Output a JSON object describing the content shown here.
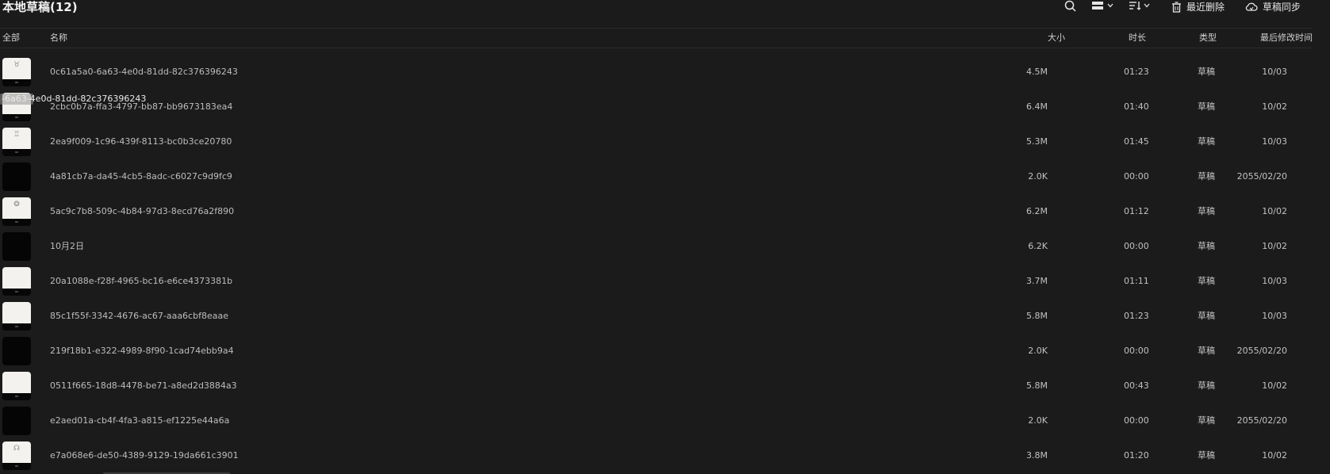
{
  "header": {
    "title": "本地草稿(12)",
    "recent_delete_label": "最近删除",
    "sync_label": "草稿同步"
  },
  "icons": {
    "search": "search-icon",
    "layout": "layout-view-icon",
    "sort": "sort-icon",
    "trash": "trash-icon",
    "cloud": "cloud-sync-icon"
  },
  "columns": {
    "all": "全部",
    "name": "名称",
    "size": "大小",
    "duration": "时长",
    "type": "类型",
    "modified": "最后修改时间"
  },
  "drag_ghost": {
    "text": "-6a63-4e0d-81dd-82c376396243"
  },
  "rows": [
    {
      "name": "0c61a5a0-6a63-4e0d-81dd-82c376396243",
      "size": "4.5M",
      "duration": "01:23",
      "type": "草稿",
      "modified": "10/03",
      "thumb": "paper",
      "glyph": "♉"
    },
    {
      "name": "2cbc0b7a-ffa3-4797-bb87-bb9673183ea4",
      "size": "6.4M",
      "duration": "01:40",
      "type": "草稿",
      "modified": "10/02",
      "thumb": "paper",
      "glyph": ""
    },
    {
      "name": "2ea9f009-1c96-439f-8113-bc0b3ce20780",
      "size": "5.3M",
      "duration": "01:45",
      "type": "草稿",
      "modified": "10/03",
      "thumb": "paper",
      "glyph": "♖"
    },
    {
      "name": "4a81cb7a-da45-4cb5-8adc-c6027c9d9fc9",
      "size": "2.0K",
      "duration": "00:00",
      "type": "草稿",
      "modified": "2055/02/20",
      "thumb": "dark",
      "glyph": ""
    },
    {
      "name": "5ac9c7b8-509c-4b84-97d3-8ecd76a2f890",
      "size": "6.2M",
      "duration": "01:12",
      "type": "草稿",
      "modified": "10/02",
      "thumb": "paper",
      "glyph": "❂"
    },
    {
      "name": "10月2日",
      "size": "6.2K",
      "duration": "00:00",
      "type": "草稿",
      "modified": "10/02",
      "thumb": "dark",
      "glyph": ""
    },
    {
      "name": "20a1088e-f28f-4965-bc16-e6ce4373381b",
      "size": "3.7M",
      "duration": "01:11",
      "type": "草稿",
      "modified": "10/03",
      "thumb": "paper",
      "glyph": ""
    },
    {
      "name": "85c1f55f-3342-4676-ac67-aaa6cbf8eaae",
      "size": "5.8M",
      "duration": "01:23",
      "type": "草稿",
      "modified": "10/03",
      "thumb": "paper",
      "glyph": ""
    },
    {
      "name": "219f18b1-e322-4989-8f90-1cad74ebb9a4",
      "size": "2.0K",
      "duration": "00:00",
      "type": "草稿",
      "modified": "2055/02/20",
      "thumb": "dark",
      "glyph": ""
    },
    {
      "name": "0511f665-18d8-4478-be71-a8ed2d3884a3",
      "size": "5.8M",
      "duration": "00:43",
      "type": "草稿",
      "modified": "10/02",
      "thumb": "paper",
      "glyph": ""
    },
    {
      "name": "e2aed01a-cb4f-4fa3-a815-ef1225e44a6a",
      "size": "2.0K",
      "duration": "00:00",
      "type": "草稿",
      "modified": "2055/02/20",
      "thumb": "dark",
      "glyph": ""
    },
    {
      "name": "e7a068e6-de50-4389-9129-19da661c3901",
      "size": "3.8M",
      "duration": "01:20",
      "type": "草稿",
      "modified": "10/02",
      "thumb": "paper",
      "glyph": "☊"
    }
  ]
}
